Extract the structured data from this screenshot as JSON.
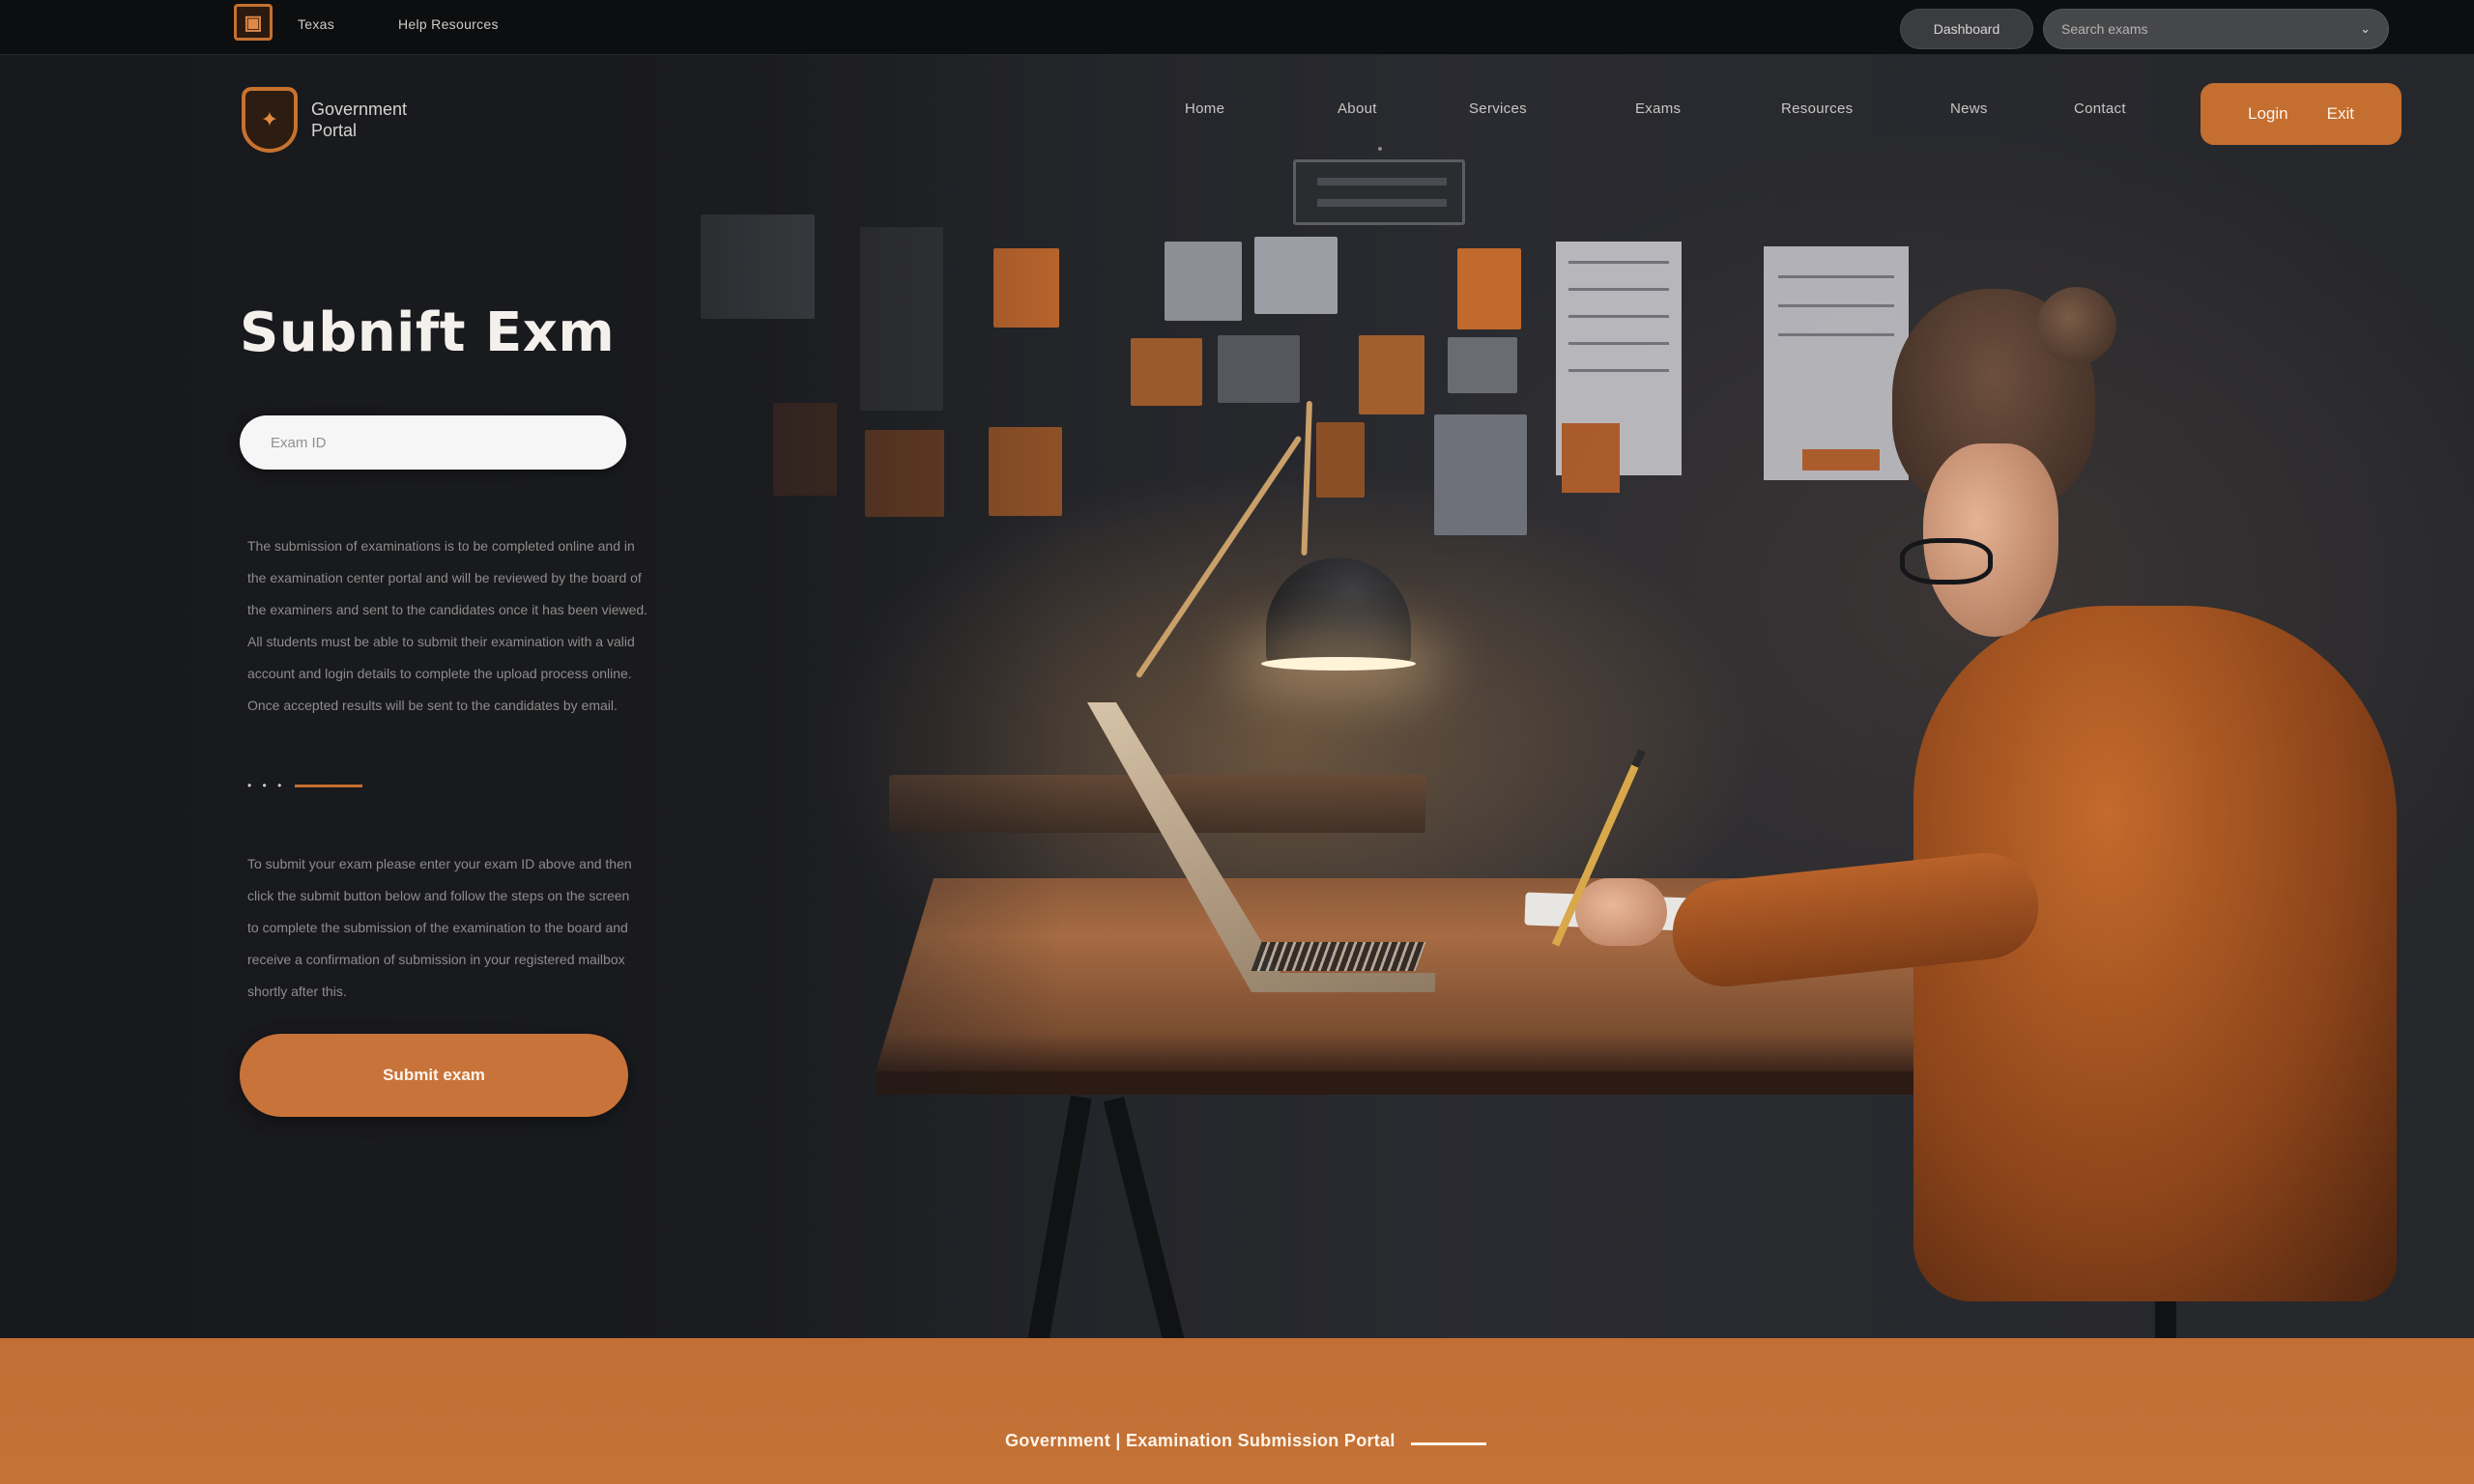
{
  "topbar": {
    "logo_glyph": "▣",
    "links": [
      "Texas",
      "Help Resources"
    ],
    "util_button": "Dashboard",
    "search_placeholder": "Search exams",
    "search_chevron": "⌄"
  },
  "header": {
    "logo_icon": "shield-icon",
    "logo_glyph": "✦",
    "brand_line1": "Government",
    "brand_line2": "Portal",
    "nav": [
      "Home",
      "About",
      "Services",
      "Exams",
      "Resources",
      "News",
      "Contact"
    ],
    "cta_left": "Login",
    "cta_right": "Exit"
  },
  "main": {
    "title": "Subnift Exm",
    "exam_input_placeholder": "Exam ID",
    "description_1": [
      "The submission of examinations is to be completed online and in",
      "the examination center portal and will be reviewed by the board of",
      "the examiners and sent to the candidates once it has been viewed.",
      "All students must be able to submit their examination with a valid",
      "account and login details to complete the upload process online.",
      "Once accepted results will be sent to the candidates by email."
    ],
    "divider_dots": "• • •",
    "description_2": [
      "To submit your exam please enter your exam ID above and then",
      "click the submit button below and follow the steps on the screen",
      "to complete the submission of the examination to the board and",
      "receive a confirmation of submission in your registered mailbox",
      "shortly after this."
    ],
    "submit_label": "Submit exam"
  },
  "footer": {
    "text": "Government | Examination Submission Portal"
  },
  "colors": {
    "accent": "#c46e2f",
    "background": "#1d1e22",
    "footer": "#c26f35"
  }
}
